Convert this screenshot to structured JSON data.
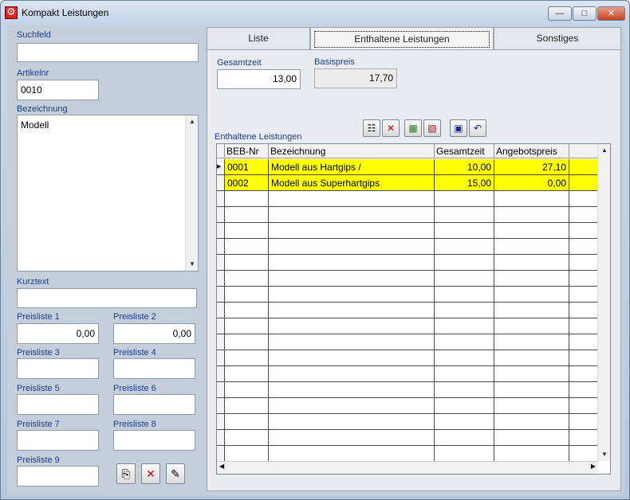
{
  "window": {
    "title": "Kompakt Leistungen",
    "min": "—",
    "max": "□",
    "close": "✕"
  },
  "left": {
    "suchfeld_label": "Suchfeld",
    "suchfeld_value": "",
    "artikelnr_label": "Artikelnr",
    "artikelnr_value": "0010",
    "bezeichnung_label": "Bezeichnung",
    "bezeichnung_value": "Modell",
    "kurztext_label": "Kurztext",
    "kurztext_value": "",
    "preislisten": [
      {
        "label": "Preisliste 1",
        "value": "0,00"
      },
      {
        "label": "Preisliste 2",
        "value": "0,00"
      },
      {
        "label": "Preisliste 3",
        "value": ""
      },
      {
        "label": "Preisliste 4",
        "value": ""
      },
      {
        "label": "Preisliste 5",
        "value": ""
      },
      {
        "label": "Preisliste 6",
        "value": ""
      },
      {
        "label": "Preisliste 7",
        "value": ""
      },
      {
        "label": "Preisliste 8",
        "value": ""
      },
      {
        "label": "Preisliste 9",
        "value": ""
      }
    ]
  },
  "tabs": [
    {
      "label": "Liste",
      "active": false
    },
    {
      "label": "Enthaltene Leistungen",
      "active": true
    },
    {
      "label": "Sonstiges",
      "active": false
    }
  ],
  "panel": {
    "gesamtzeit_label": "Gesamtzeit",
    "gesamtzeit_value": "13,00",
    "basispreis_label": "Basispreis",
    "basispreis_value": "17,70",
    "grid_label": "Enthaltene Leistungen"
  },
  "grid": {
    "columns": [
      "BEB-Nr",
      "Bezeichnung",
      "Gesamtzeit",
      "Angebotspreis"
    ],
    "rows": [
      {
        "beb": "0001",
        "bezeichnung": "Modell aus Hartgips /",
        "zeit": "10,00",
        "preis": "27,10"
      },
      {
        "beb": "0002",
        "bezeichnung": "Modell aus Superhartgips",
        "zeit": "15,00",
        "preis": "0,00"
      }
    ],
    "empty_rows": 17
  },
  "icons": {
    "up_arrow": "▲",
    "down_arrow": "▼",
    "left_arrow": "◀",
    "right_arrow": "▶",
    "row_marker": "▶",
    "copy": "⎘",
    "delete": "✕",
    "edit": "✎",
    "tree": "☷",
    "calc1": "▦",
    "calc2": "▧",
    "save": "▣",
    "undo": "↶"
  }
}
